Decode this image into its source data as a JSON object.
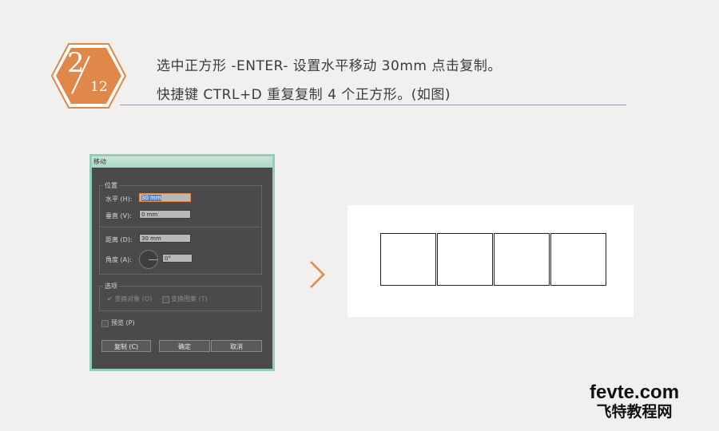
{
  "step": {
    "current": "2",
    "total": "12"
  },
  "instructions": {
    "line1": "选中正方形 -ENTER- 设置水平移动 30mm 点击复制。",
    "line2": "快捷键 CTRL+D 重复复制 4 个正方形。(如图)"
  },
  "colors": {
    "accent": "#e0884a",
    "background": "#f1f0ee"
  },
  "dialog": {
    "title": "移动",
    "position_group": "位置",
    "horizontal_label": "水平 (H):",
    "horizontal_value": "30 mm",
    "vertical_label": "垂直 (V):",
    "vertical_value": "0 mm",
    "distance_label": "距离 (D):",
    "distance_value": "30 mm",
    "angle_label": "角度 (A):",
    "angle_value": "0°",
    "options_group": "选项",
    "transform_objects_label": "变换对象 (O)",
    "transform_patterns_label": "变换图案 (T)",
    "preview_label": "预览 (P)",
    "copy_button": "复制 (C)",
    "ok_button": "确定",
    "cancel_button": "取消"
  },
  "canvas": {
    "square_count": 4
  },
  "watermark": {
    "line1": "fevte.com",
    "line2": "飞特教程网"
  }
}
